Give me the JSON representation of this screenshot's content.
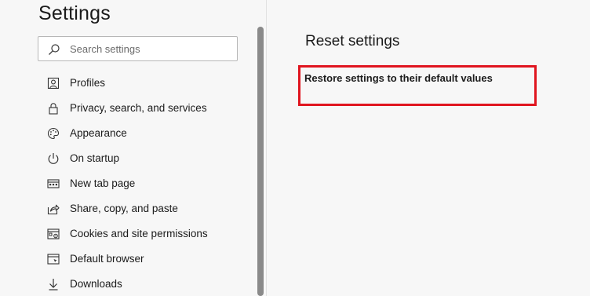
{
  "sidebar": {
    "title": "Settings",
    "search": {
      "placeholder": "Search settings",
      "value": ""
    },
    "items": [
      {
        "label": "Profiles",
        "icon": "profile-icon"
      },
      {
        "label": "Privacy, search, and services",
        "icon": "lock-icon"
      },
      {
        "label": "Appearance",
        "icon": "palette-icon"
      },
      {
        "label": "On startup",
        "icon": "power-icon"
      },
      {
        "label": "New tab page",
        "icon": "new-tab-icon"
      },
      {
        "label": "Share, copy, and paste",
        "icon": "share-icon"
      },
      {
        "label": "Cookies and site permissions",
        "icon": "site-permissions-icon"
      },
      {
        "label": "Default browser",
        "icon": "default-browser-icon"
      },
      {
        "label": "Downloads",
        "icon": "download-icon"
      }
    ]
  },
  "main": {
    "title": "Reset settings",
    "restore_label": "Restore settings to their default values"
  },
  "colors": {
    "highlight": "#e0151f",
    "background": "#f7f7f7"
  }
}
